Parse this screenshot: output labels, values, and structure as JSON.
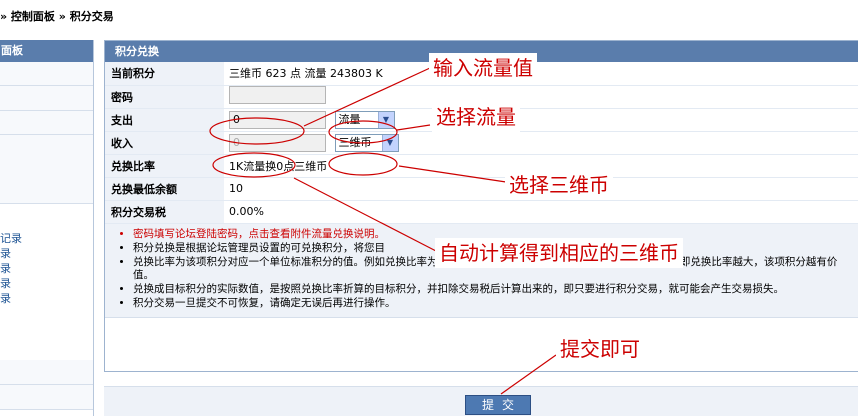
{
  "breadcrumb": {
    "part1": "» 控制面板",
    "part2": "» 积分交易"
  },
  "sidebar": {
    "header": "面板",
    "links": [
      "记录",
      "录",
      "录",
      "录",
      "录"
    ]
  },
  "panel": {
    "title": "积分兑换",
    "rows": {
      "current_credits": {
        "label": "当前积分",
        "value": "三维币 623 点  流量 243803 K"
      },
      "password": {
        "label": "密码",
        "value": ""
      },
      "expense": {
        "label": "支出",
        "value": "0",
        "select": "流量"
      },
      "income": {
        "label": "收入",
        "value": "0",
        "select": "三维币"
      },
      "ratio": {
        "label": "兑换比率",
        "value": "1K流量换0点三维币"
      },
      "min_balance": {
        "label": "兑换最低余额",
        "value": "10"
      },
      "tax": {
        "label": "积分交易税",
        "value": "0.00%"
      }
    },
    "tips": [
      "密码填写论坛登陆密码，点击查看附件流量兑换说明。",
      "积分兑换是根据论坛管理员设置的可兑换积分，将您目",
      "兑换比率为该项积分对应一个单位标准积分的值。例如兑换比率为 2 的积分 1 分，相当于兑换比率为 1 的积分 2 分，即兑换比率越大，该项积分越有价值。",
      "兑换成目标积分的实际数值，是按照兑换比率折算的目标积分，并扣除交易税后计算出来的，即只要进行积分交易，就可能会产生交易损失。",
      "积分交易一旦提交不可恢复，请确定无误后再进行操作。"
    ]
  },
  "submit_label": "提交",
  "annotations": {
    "input_traffic": "输入流量值",
    "select_traffic": "选择流量",
    "select_coin": "选择三维币",
    "auto_calc": "自动计算得到相应的三维币",
    "submit_hint": "提交即可"
  },
  "colors": {
    "annotation": "#cc0000",
    "panel_header": "#5a7dac",
    "label_bg": "#eef2f8",
    "submit_bg": "#4d79b2"
  }
}
